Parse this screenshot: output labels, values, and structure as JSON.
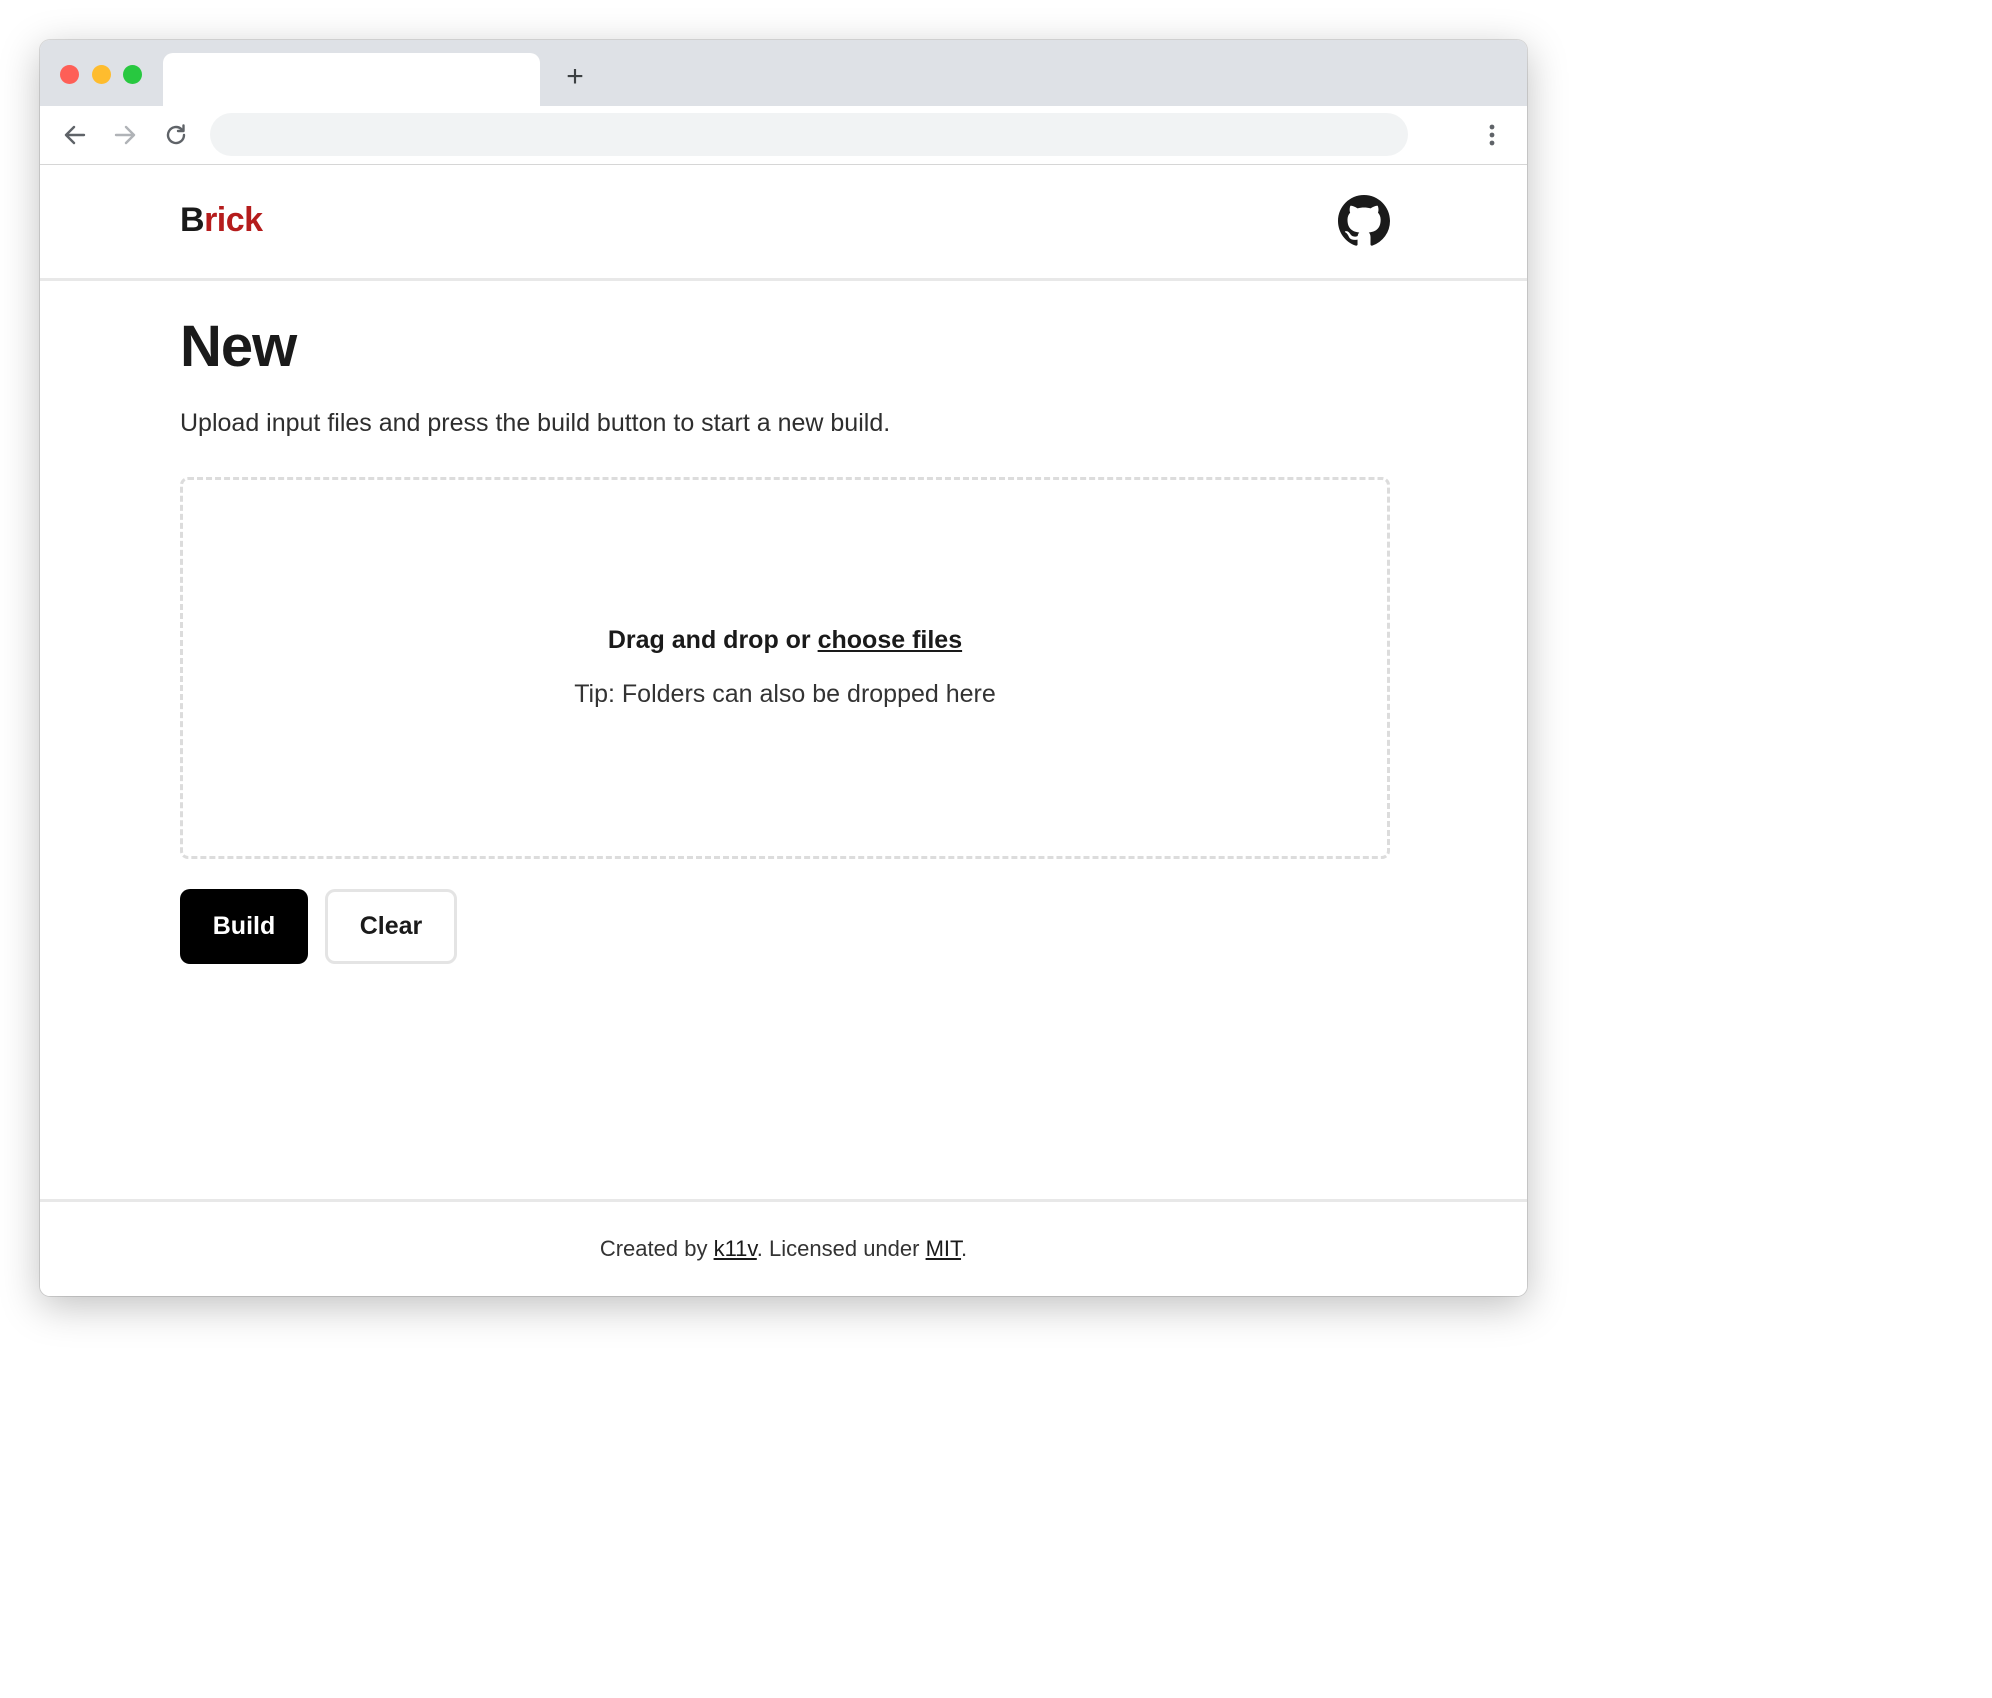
{
  "browser": {
    "new_tab_label": "+",
    "icons": {
      "back": "arrow-left-icon",
      "forward": "arrow-right-icon",
      "reload": "reload-icon",
      "menu": "kebab-menu-icon",
      "new_tab": "plus-icon"
    }
  },
  "header": {
    "logo_first": "B",
    "logo_rest": "rick",
    "logo_color": "#b51c1c",
    "github_icon": "github-icon"
  },
  "main": {
    "title": "New",
    "intro": "Upload input files and press the build button to start a new build.",
    "dropzone": {
      "prefix": "Drag and drop or ",
      "link": "choose files",
      "tip": "Tip: Folders can also be dropped here"
    },
    "build_label": "Build",
    "clear_label": "Clear"
  },
  "footer": {
    "created_by": "Created by ",
    "author": "k11v",
    "licensed": ". Licensed under ",
    "license": "MIT",
    "end": "."
  }
}
